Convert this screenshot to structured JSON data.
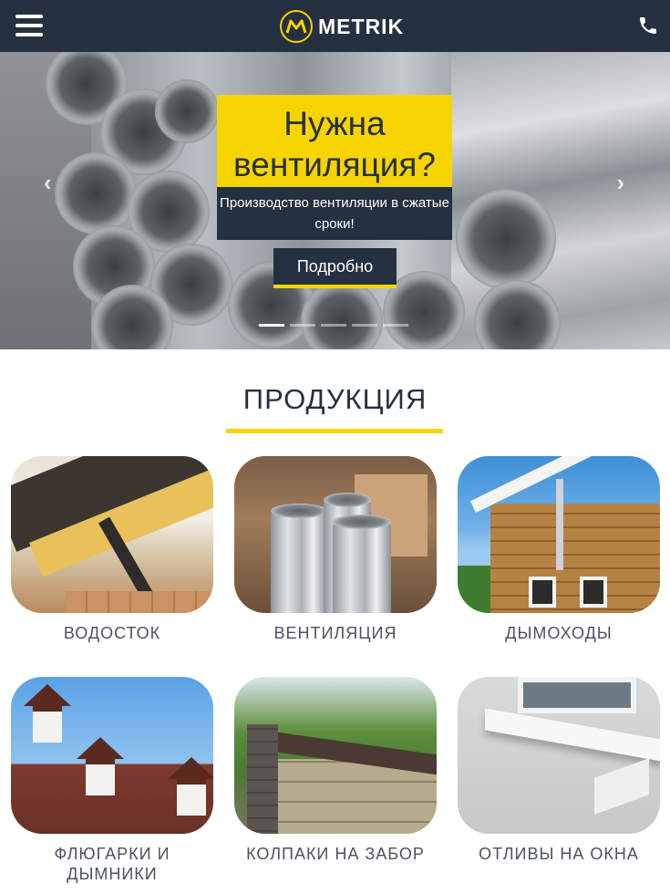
{
  "header": {
    "brand": "METRIK",
    "menu_icon": "hamburger-menu-icon",
    "phone_icon": "phone-icon",
    "logo_icon": "metrik-m-logo-icon",
    "bg_color": "#253040",
    "accent_color": "#f7d400"
  },
  "hero": {
    "title_line1": "Нужна",
    "title_line2": "вентиляция?",
    "subtitle": "Производство вентиляции в сжатые сроки!",
    "button_label": "Подробно",
    "prev_icon": "chevron-left-icon",
    "next_icon": "chevron-right-icon",
    "slides_count": 5,
    "active_slide": 1,
    "prev_glyph": "‹",
    "next_glyph": "›"
  },
  "products": {
    "title": "ПРОДУКЦИЯ",
    "items": [
      {
        "label": "ВОДОСТОК"
      },
      {
        "label": "ВЕНТИЛЯЦИЯ"
      },
      {
        "label": "ДЫМОХОДЫ"
      },
      {
        "label": "ФЛЮГАРКИ И ДЫМНИКИ"
      },
      {
        "label": "КОЛПАКИ НА ЗАБОР"
      },
      {
        "label": "ОТЛИВЫ НА ОКНА"
      }
    ]
  }
}
